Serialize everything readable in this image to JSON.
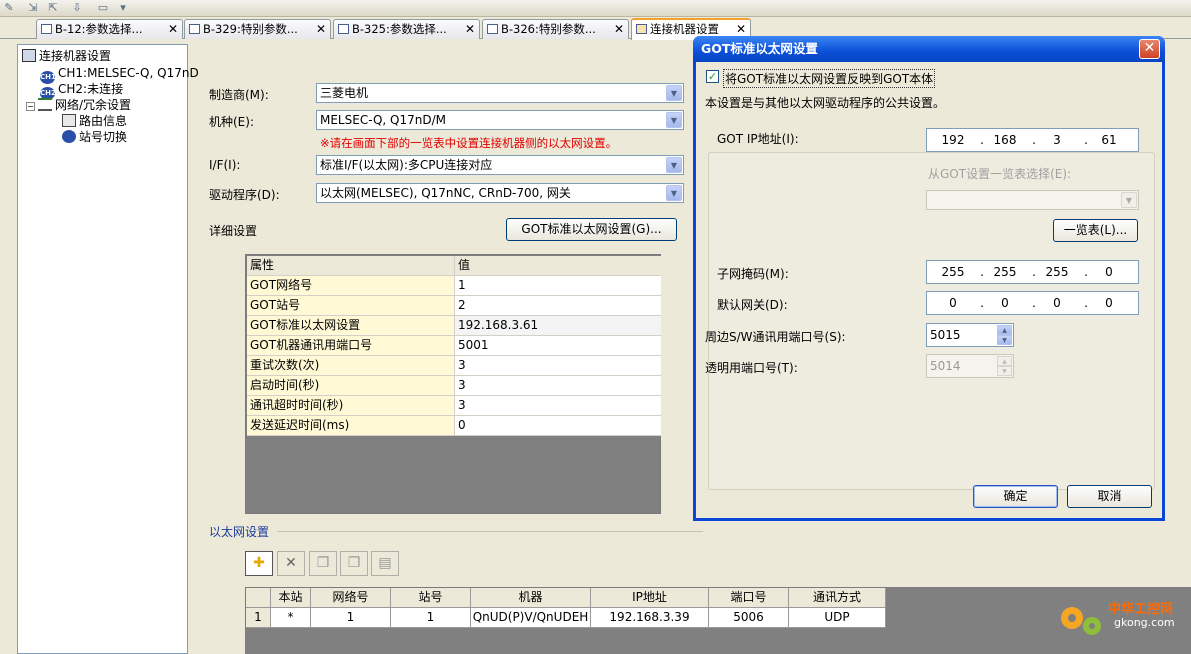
{
  "tabs": [
    {
      "label": "B-12:参数选择...",
      "close": "✕"
    },
    {
      "label": "B-329:特别参数...",
      "close": "✕"
    },
    {
      "label": "B-325:参数选择...",
      "close": "✕"
    },
    {
      "label": "B-326:特别参数...",
      "close": "✕"
    },
    {
      "label": "连接机器设置",
      "close": "✕"
    }
  ],
  "tree": {
    "root": "连接机器设置",
    "ch1": "CH1:MELSEC-Q, Q17nD",
    "ch2": "CH2:未连接",
    "network": "网络/冗余设置",
    "route": "路由信息",
    "station": "站号切换",
    "ch1_icon": "CH1",
    "ch2_icon": "CH2"
  },
  "form": {
    "maker_label": "制造商(M):",
    "maker_value": "三菱电机",
    "model_label": "机种(E):",
    "model_value": "MELSEC-Q, Q17nD/M",
    "warning": "※请在画面下部的一览表中设置连接机器侧的以太网设置。",
    "if_label": "I/F(I):",
    "if_value": "标准I/F(以太网):多CPU连接对应",
    "driver_label": "驱动程序(D):",
    "driver_value": "以太网(MELSEC), Q17nNC, CRnD-700, 网关",
    "detail_label": "详细设置",
    "got_eth_button": "GOT标准以太网设置(G)..."
  },
  "property_grid": {
    "header_key": "属性",
    "header_value": "值",
    "rows": [
      {
        "k": "GOT网络号",
        "v": "1"
      },
      {
        "k": "GOT站号",
        "v": "2"
      },
      {
        "k": "GOT标准以太网设置",
        "v": "192.168.3.61"
      },
      {
        "k": "GOT机器通讯用端口号",
        "v": "5001"
      },
      {
        "k": "重试次数(次)",
        "v": "3"
      },
      {
        "k": "启动时间(秒)",
        "v": "3"
      },
      {
        "k": "通讯超时时间(秒)",
        "v": "3"
      },
      {
        "k": "发送延迟时间(ms)",
        "v": "0"
      }
    ]
  },
  "ethernet": {
    "title": "以太网设置",
    "columns": [
      "",
      "本站",
      "网络号",
      "站号",
      "机器",
      "IP地址",
      "端口号",
      "通讯方式"
    ],
    "rows": [
      [
        "1",
        "*",
        "1",
        "1",
        "QnUD(P)V/QnUDEH",
        "192.168.3.39",
        "5006",
        "UDP"
      ]
    ]
  },
  "dialog": {
    "title": "GOT标准以太网设置",
    "close": "✕",
    "reflect_checkbox": "将GOT标准以太网设置反映到GOT本体",
    "reflect_mark": "✓",
    "description": "本设置是与其他以太网驱动程序的公共设置。",
    "ip_label": "GOT IP地址(I):",
    "ip": [
      "192",
      "168",
      "3",
      "61"
    ],
    "select_label": "从GOT设置一览表选择(E):",
    "list_button": "一览表(L)...",
    "subnet_label": "子网掩码(M):",
    "subnet": [
      "255",
      "255",
      "255",
      "0"
    ],
    "gateway_label": "默认网关(D):",
    "gateway": [
      "0",
      "0",
      "0",
      "0"
    ],
    "peripheral_label": "周边S/W通讯用端口号(S):",
    "peripheral_port": "5015",
    "transparent_label": "透明用端口号(T):",
    "transparent_port": "5014",
    "ok": "确定",
    "cancel": "取消"
  },
  "watermark": {
    "cn": "中华工控网",
    "url": "gkong.com"
  }
}
